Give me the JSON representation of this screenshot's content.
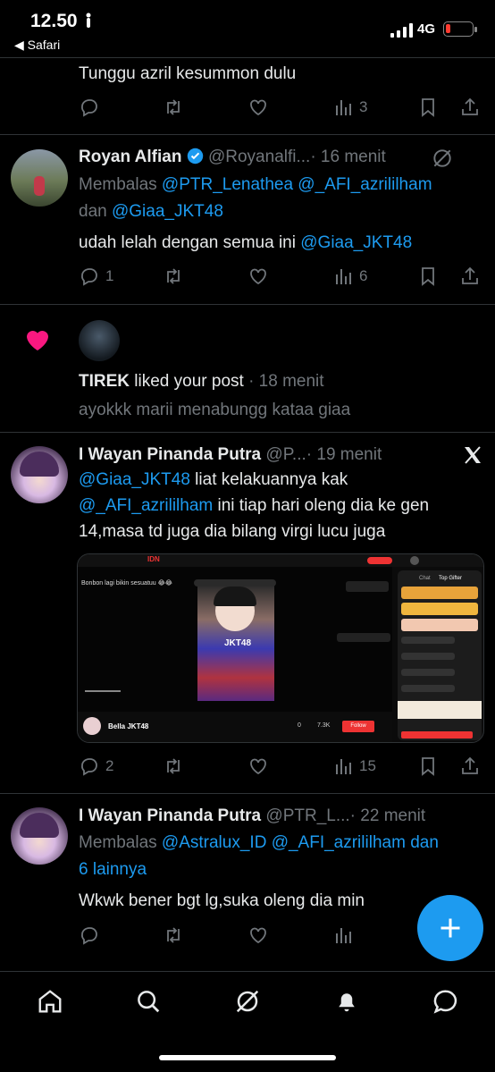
{
  "status_bar": {
    "time": "12.50",
    "back_app": "◀ Safari",
    "network": "4G"
  },
  "tweets": [
    {
      "text": "Tunggu azril kesummon dulu",
      "views": "3"
    },
    {
      "name": "Royan Alfian",
      "handle": "@Royanalfi...",
      "time": "· 16 menit",
      "reply_prefix": "Membalas ",
      "reply_line1_links": "@PTR_Lenathea @_AFI_azrililham",
      "reply_line2_pre": "dan ",
      "reply_line2_link": "@Giaa_JKT48",
      "text": "udah lelah dengan semua ini ",
      "text_link": "@Giaa_JKT48",
      "replies": "1",
      "views": "6"
    },
    {
      "name": "I Wayan Pinanda Putra",
      "handle": "@P...",
      "time": "· 19 menit",
      "line1_link": "@Giaa_JKT48",
      "line1_text": " liat kelakuannya kak",
      "line2_link": "@_AFI_azrililham",
      "line2_text": " ini tiap hari oleng dia ke gen",
      "line3_text": "14,masa td juga dia bilang virgi lucu juga",
      "replies": "2",
      "views": "15"
    },
    {
      "name": "I Wayan Pinanda Putra",
      "handle": "@PTR_L...",
      "time": "· 22 menit",
      "reply_prefix": "Membalas ",
      "reply_line1_links": "@Astralux_ID @_AFI_azrililham",
      "reply_line1_post": " dan",
      "reply_line2": "6 lainnya",
      "text": "Wkwk bener bgt lg,suka oleng dia min"
    }
  ],
  "notification": {
    "actor": "TIREK",
    "action": " liked your post",
    "time": " · 18 menit",
    "snippet": "ayokkk marii menabungg kataa giaa"
  },
  "media": {
    "brand": "IDN",
    "caption": "Bonbon lagi bikin sesuatuu 😂😂",
    "streamer": "Bella JKT48",
    "viewers": "0",
    "followers": "7.3K",
    "follow_label": "Follow",
    "tab_chat": "Chat",
    "tab_top": "Top Gifter",
    "jkt_label": "JKT48"
  },
  "colors": {
    "accent": "#1d9bf0",
    "like": "#f91880",
    "muted": "#71767b"
  },
  "icons": [
    "reply-icon",
    "retweet-icon",
    "like-icon",
    "views-icon",
    "bookmark-icon",
    "share-icon",
    "verified-icon",
    "grok-icon",
    "x-logo-icon",
    "heart-icon",
    "plus-icon",
    "home-icon",
    "search-icon",
    "grok-tab-icon",
    "bell-icon",
    "chat-icon"
  ]
}
